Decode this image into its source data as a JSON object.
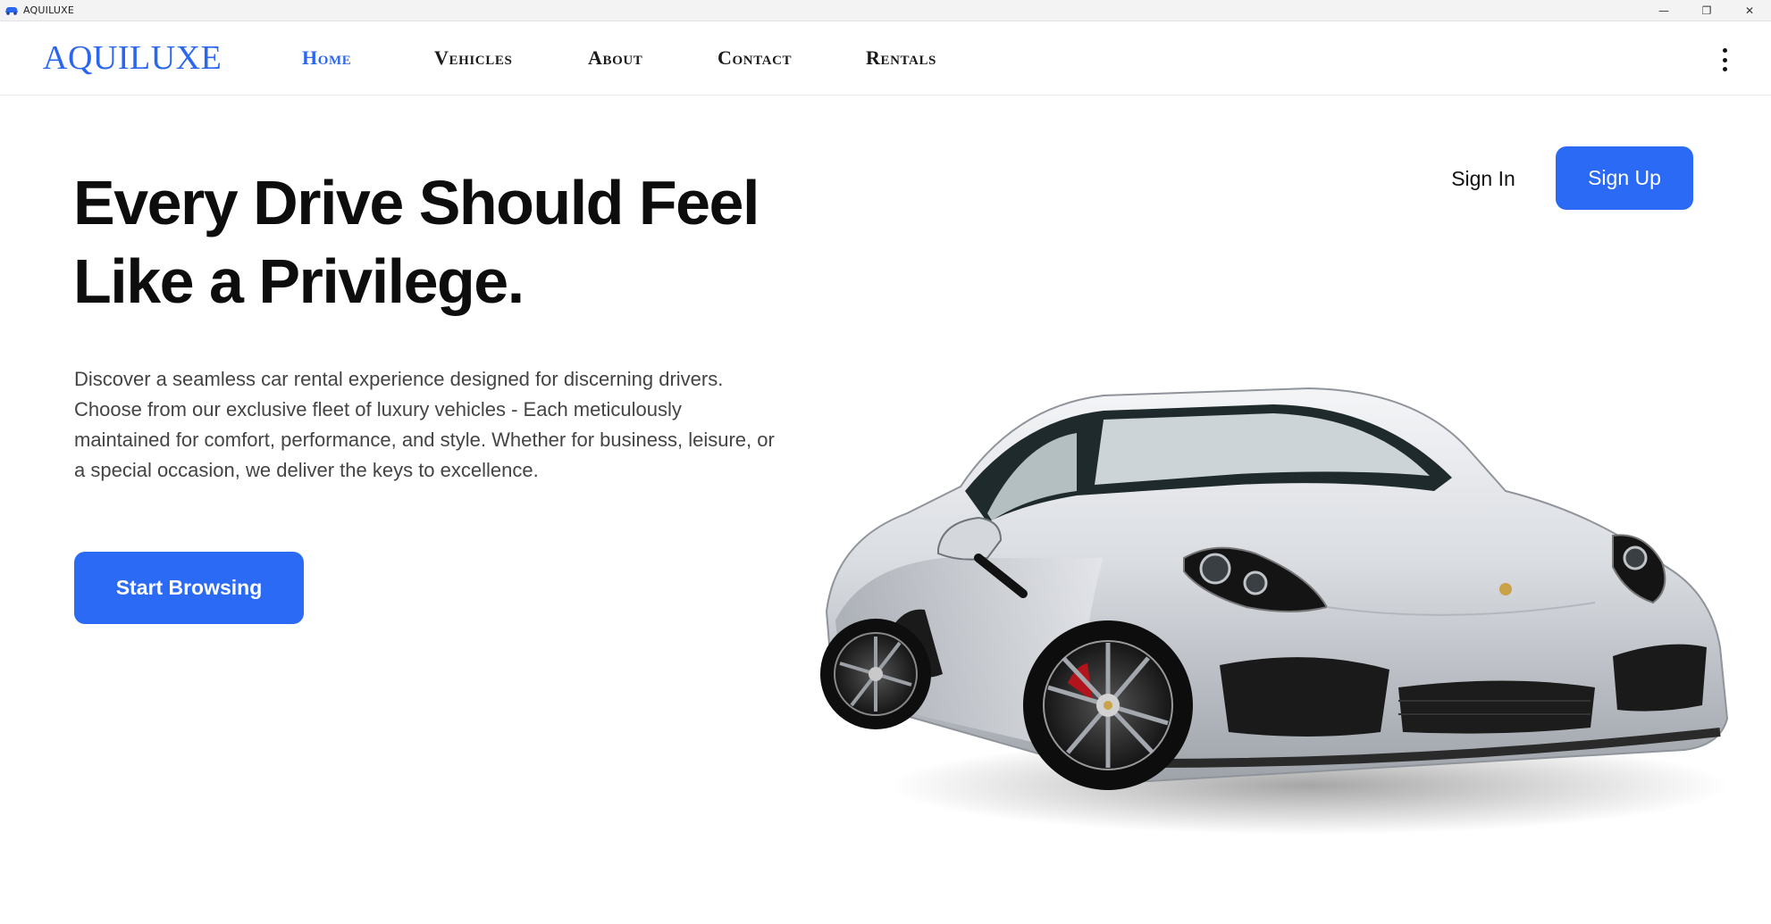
{
  "window": {
    "title": "AQUILUXE",
    "controls": {
      "minimize": "—",
      "restore": "❐",
      "close": "✕"
    }
  },
  "nav": {
    "logo": "AQUILUXE",
    "links": [
      {
        "label": "Home",
        "active": true
      },
      {
        "label": "Vehicles",
        "active": false
      },
      {
        "label": "About",
        "active": false
      },
      {
        "label": "Contact",
        "active": false
      },
      {
        "label": "Rentals",
        "active": false
      }
    ],
    "menu_icon": "more-vertical-icon"
  },
  "hero": {
    "headline_line1": "Every Drive Should Feel",
    "headline_line2": "Like a Privilege.",
    "description": "Discover a seamless car rental experience designed for discerning drivers. Choose from our exclusive fleet of luxury vehicles - Each meticulously maintained for comfort, performance, and style. Whether for business, leisure, or a special occasion, we deliver the keys to excellence.",
    "cta_label": "Start Browsing",
    "image_subject": "silver sports car"
  },
  "auth": {
    "signin_label": "Sign In",
    "signup_label": "Sign Up"
  },
  "colors": {
    "accent": "#2b6af5",
    "logo": "#2b66f0",
    "text": "#0d0d0d",
    "body_text": "#444444"
  }
}
